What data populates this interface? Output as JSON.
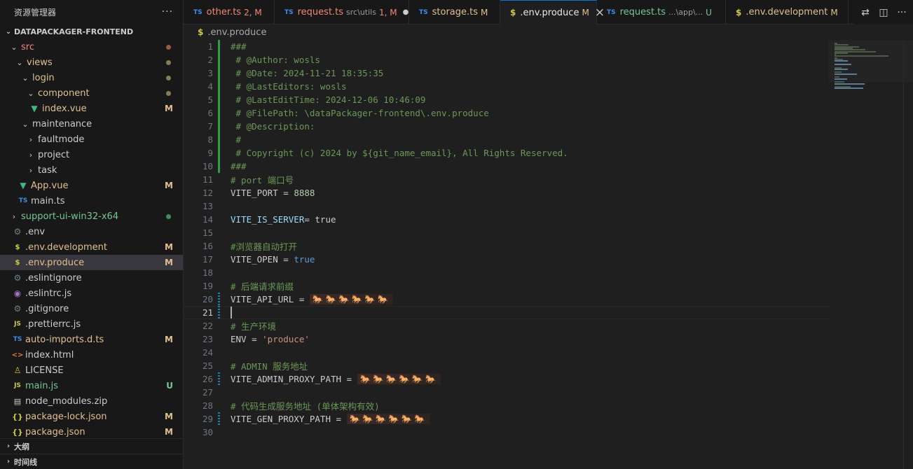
{
  "explorer": {
    "title": "资源管理器",
    "more": "···",
    "project": "DATAPACKAGER-FRONTEND",
    "items": [
      {
        "label": "src",
        "depth": 0,
        "kind": "folder-open",
        "icon": "",
        "color": "red",
        "dot": "#9b5b49"
      },
      {
        "label": "views",
        "depth": 1,
        "kind": "folder-open",
        "icon": "",
        "color": "mod",
        "dot": "#8b7a56"
      },
      {
        "label": "login",
        "depth": 2,
        "kind": "folder-open",
        "icon": "",
        "color": "mod",
        "dot": "#8b7a56"
      },
      {
        "label": "component",
        "depth": 3,
        "kind": "folder-open",
        "icon": "",
        "color": "mod",
        "dot": "#8b7a56"
      },
      {
        "label": "index.vue",
        "depth": 3,
        "kind": "file",
        "icon": "vue",
        "color": "mod",
        "badge": "M"
      },
      {
        "label": "maintenance",
        "depth": 2,
        "kind": "folder-open",
        "icon": "",
        "color": "def"
      },
      {
        "label": "faultmode",
        "depth": 3,
        "kind": "folder",
        "icon": "",
        "color": "def"
      },
      {
        "label": "project",
        "depth": 3,
        "kind": "folder",
        "icon": "",
        "color": "def"
      },
      {
        "label": "task",
        "depth": 3,
        "kind": "folder",
        "icon": "",
        "color": "def"
      },
      {
        "label": "App.vue",
        "depth": 1,
        "kind": "file",
        "icon": "vue",
        "color": "mod",
        "badge": "M"
      },
      {
        "label": "main.ts",
        "depth": 1,
        "kind": "file",
        "icon": "ts",
        "color": "def"
      },
      {
        "label": "support-ui-win32-x64",
        "depth": 0,
        "kind": "folder",
        "icon": "",
        "color": "untr",
        "dot": "#3f8e5c"
      },
      {
        "label": ".env",
        "depth": 0,
        "kind": "file",
        "icon": "gear",
        "color": "def"
      },
      {
        "label": ".env.development",
        "depth": 0,
        "kind": "file",
        "icon": "env",
        "color": "mod",
        "badge": "M"
      },
      {
        "label": ".env.produce",
        "depth": 0,
        "kind": "file",
        "icon": "env",
        "color": "mod",
        "badge": "M",
        "selected": true
      },
      {
        "label": ".eslintignore",
        "depth": 0,
        "kind": "file",
        "icon": "gear",
        "color": "def"
      },
      {
        "label": ".eslintrc.js",
        "depth": 0,
        "kind": "file",
        "icon": "eslint",
        "color": "def"
      },
      {
        "label": ".gitignore",
        "depth": 0,
        "kind": "file",
        "icon": "gear",
        "color": "def"
      },
      {
        "label": ".prettierrc.js",
        "depth": 0,
        "kind": "file",
        "icon": "js",
        "color": "def"
      },
      {
        "label": "auto-imports.d.ts",
        "depth": 0,
        "kind": "file",
        "icon": "ts",
        "color": "mod",
        "badge": "M"
      },
      {
        "label": "index.html",
        "depth": 0,
        "kind": "file",
        "icon": "html",
        "color": "def"
      },
      {
        "label": "LICENSE",
        "depth": 0,
        "kind": "file",
        "icon": "license",
        "color": "def"
      },
      {
        "label": "main.js",
        "depth": 0,
        "kind": "file",
        "icon": "js",
        "color": "untr",
        "badge": "U"
      },
      {
        "label": "node_modules.zip",
        "depth": 0,
        "kind": "file",
        "icon": "zip",
        "color": "def"
      },
      {
        "label": "package-lock.json",
        "depth": 0,
        "kind": "file",
        "icon": "json",
        "color": "mod",
        "badge": "M"
      },
      {
        "label": "package.json",
        "depth": 0,
        "kind": "file",
        "icon": "json",
        "color": "mod",
        "badge": "M"
      }
    ],
    "panels": [
      "大纲",
      "时间线"
    ]
  },
  "tabs": [
    {
      "icon": "TS",
      "icon_kind": "ts",
      "label": "other.ts",
      "desc": "",
      "status": "2, M",
      "color": "#f48771",
      "active": false
    },
    {
      "icon": "TS",
      "icon_kind": "ts",
      "label": "request.ts",
      "desc": "src\\utils",
      "status": "1, M",
      "color": "#f48771",
      "active": false,
      "dirty": true
    },
    {
      "icon": "TS",
      "icon_kind": "ts",
      "label": "storage.ts",
      "desc": "",
      "status": "M",
      "color": "#e2c08d",
      "active": false
    },
    {
      "icon": "$",
      "icon_kind": "env",
      "label": ".env.produce",
      "desc": "",
      "status": "M",
      "color": "#e2c08d",
      "active": true,
      "closable": true
    },
    {
      "icon": "TS",
      "icon_kind": "ts",
      "label": "request.ts",
      "desc": "...\\app\\...",
      "status": "U",
      "color": "#73c991",
      "active": false
    },
    {
      "icon": "$",
      "icon_kind": "env",
      "label": ".env.development",
      "desc": "",
      "status": "M",
      "color": "#e2c08d",
      "active": false
    }
  ],
  "breadcrumb": {
    "icon": "$",
    "file": ".env.produce"
  },
  "editor": {
    "current_line": 21,
    "lines": [
      {
        "n": 1,
        "mark": "add",
        "tokens": [
          [
            "com",
            "###"
          ]
        ]
      },
      {
        "n": 2,
        "mark": "add",
        "tokens": [
          [
            "com",
            " # @Author: wosls"
          ]
        ]
      },
      {
        "n": 3,
        "mark": "add",
        "tokens": [
          [
            "com",
            " # @Date: 2024-11-21 18:35:35"
          ]
        ]
      },
      {
        "n": 4,
        "mark": "add",
        "tokens": [
          [
            "com",
            " # @LastEditors: wosls"
          ]
        ]
      },
      {
        "n": 5,
        "mark": "add",
        "tokens": [
          [
            "com",
            " # @LastEditTime: 2024-12-06 10:46:09"
          ]
        ]
      },
      {
        "n": 6,
        "mark": "add",
        "tokens": [
          [
            "com",
            " # @FilePath: \\dataPackager-frontend\\.env.produce"
          ]
        ]
      },
      {
        "n": 7,
        "mark": "add",
        "tokens": [
          [
            "com",
            " # @Description:"
          ]
        ]
      },
      {
        "n": 8,
        "mark": "add",
        "tokens": [
          [
            "com",
            " #"
          ]
        ]
      },
      {
        "n": 9,
        "mark": "add",
        "tokens": [
          [
            "com",
            " # Copyright (c) 2024 by ${git_name_email}, All Rights Reserved."
          ]
        ]
      },
      {
        "n": 10,
        "mark": "add",
        "tokens": [
          [
            "com",
            "###"
          ]
        ]
      },
      {
        "n": 11,
        "mark": "",
        "tokens": [
          [
            "com",
            "# port 端口号"
          ]
        ]
      },
      {
        "n": 12,
        "mark": "",
        "tokens": [
          [
            "plain",
            "VITE_PORT = "
          ],
          [
            "num",
            "8888"
          ]
        ]
      },
      {
        "n": 13,
        "mark": "",
        "tokens": []
      },
      {
        "n": 14,
        "mark": "",
        "tokens": [
          [
            "key",
            "VITE_IS_SERVER"
          ],
          [
            "plain",
            "= true"
          ]
        ]
      },
      {
        "n": 15,
        "mark": "",
        "tokens": []
      },
      {
        "n": 16,
        "mark": "",
        "tokens": [
          [
            "com",
            "#浏览器自动打开"
          ]
        ]
      },
      {
        "n": 17,
        "mark": "",
        "tokens": [
          [
            "plain",
            "VITE_OPEN = "
          ],
          [
            "bool",
            "true"
          ]
        ]
      },
      {
        "n": 18,
        "mark": "",
        "tokens": []
      },
      {
        "n": 19,
        "mark": "",
        "tokens": [
          [
            "com",
            "# 后端请求前缀"
          ]
        ]
      },
      {
        "n": 20,
        "mark": "mod",
        "tokens": [
          [
            "plain",
            "VITE_API_URL = "
          ],
          [
            "emoji",
            "🐎🐎🐎🐎🐎🐎"
          ]
        ]
      },
      {
        "n": 21,
        "mark": "mod",
        "tokens": []
      },
      {
        "n": 22,
        "mark": "",
        "tokens": [
          [
            "com",
            "# 生产环境"
          ]
        ]
      },
      {
        "n": 23,
        "mark": "",
        "tokens": [
          [
            "plain",
            "ENV = "
          ],
          [
            "str",
            "'produce'"
          ]
        ]
      },
      {
        "n": 24,
        "mark": "",
        "tokens": []
      },
      {
        "n": 25,
        "mark": "",
        "tokens": [
          [
            "com",
            "# ADMIN 服务地址"
          ]
        ]
      },
      {
        "n": 26,
        "mark": "mod",
        "tokens": [
          [
            "plain",
            "VITE_ADMIN_PROXY_PATH = "
          ],
          [
            "emoji",
            "🐎🐎🐎🐎🐎🐎"
          ]
        ]
      },
      {
        "n": 27,
        "mark": "",
        "tokens": []
      },
      {
        "n": 28,
        "mark": "",
        "tokens": [
          [
            "com",
            "# 代码生成服务地址 (单体架构有效)"
          ]
        ]
      },
      {
        "n": 29,
        "mark": "mod",
        "tokens": [
          [
            "plain",
            "VITE_GEN_PROXY_PATH = "
          ],
          [
            "emoji",
            "🐎🐎🐎🐎🐎🐎"
          ]
        ]
      },
      {
        "n": 30,
        "mark": "",
        "tokens": []
      }
    ]
  },
  "actions": [
    {
      "name": "compare-changes-icon",
      "glyph": "⇄"
    },
    {
      "name": "split-editor-icon",
      "glyph": "◫"
    },
    {
      "name": "more-actions-icon",
      "glyph": "···"
    }
  ]
}
